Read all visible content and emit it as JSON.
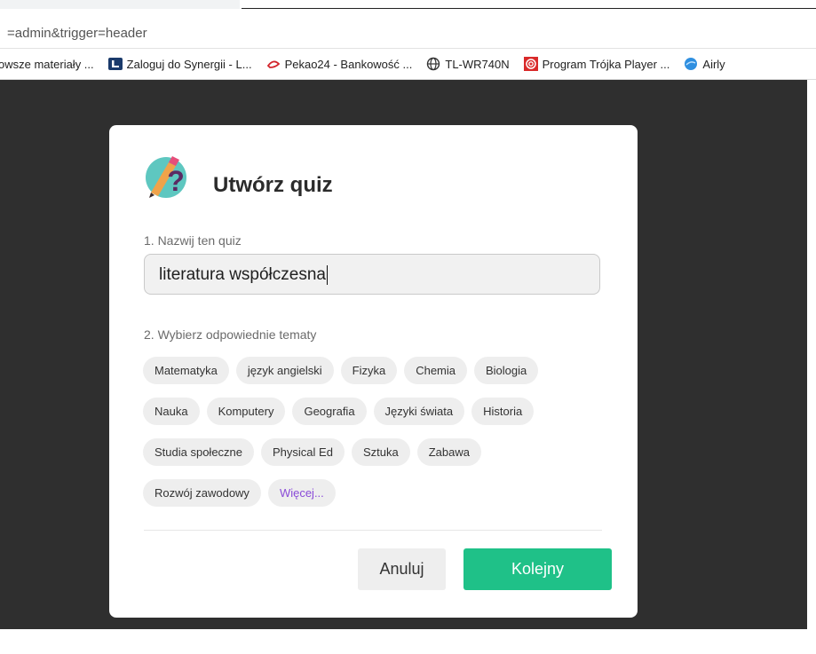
{
  "browser": {
    "url_fragment": "=admin&trigger=header",
    "bookmarks": [
      {
        "label": "owsze materiały ...",
        "icon": "bookmark-page-icon"
      },
      {
        "label": "Zaloguj do Synergii - L...",
        "icon": "synergia-icon"
      },
      {
        "label": "Pekao24 - Bankowość ...",
        "icon": "pekao-icon"
      },
      {
        "label": "TL-WR740N",
        "icon": "globe-icon"
      },
      {
        "label": "Program Trójka Player ...",
        "icon": "radio-icon"
      },
      {
        "label": "Airly",
        "icon": "airly-icon"
      }
    ]
  },
  "modal": {
    "title": "Utwórz quiz",
    "step1_label": "1. Nazwij ten quiz",
    "quiz_name_value": "literatura współczesna",
    "step2_label": "2. Wybierz odpowiednie tematy",
    "topics": [
      [
        "Matematyka",
        "język angielski",
        "Fizyka",
        "Chemia",
        "Biologia"
      ],
      [
        "Nauka",
        "Komputery",
        "Geografia",
        "Języki świata",
        "Historia"
      ],
      [
        "Studia społeczne",
        "Physical Ed",
        "Sztuka",
        "Zabawa"
      ],
      [
        "Rozwój zawodowy"
      ]
    ],
    "more_label": "Więcej...",
    "cancel_label": "Anuluj",
    "next_label": "Kolejny"
  },
  "colors": {
    "overlay": "#2f2f2f",
    "primary_button": "#1fc188",
    "more_link": "#8a4bd8",
    "tag_bg": "#eeeeee"
  }
}
